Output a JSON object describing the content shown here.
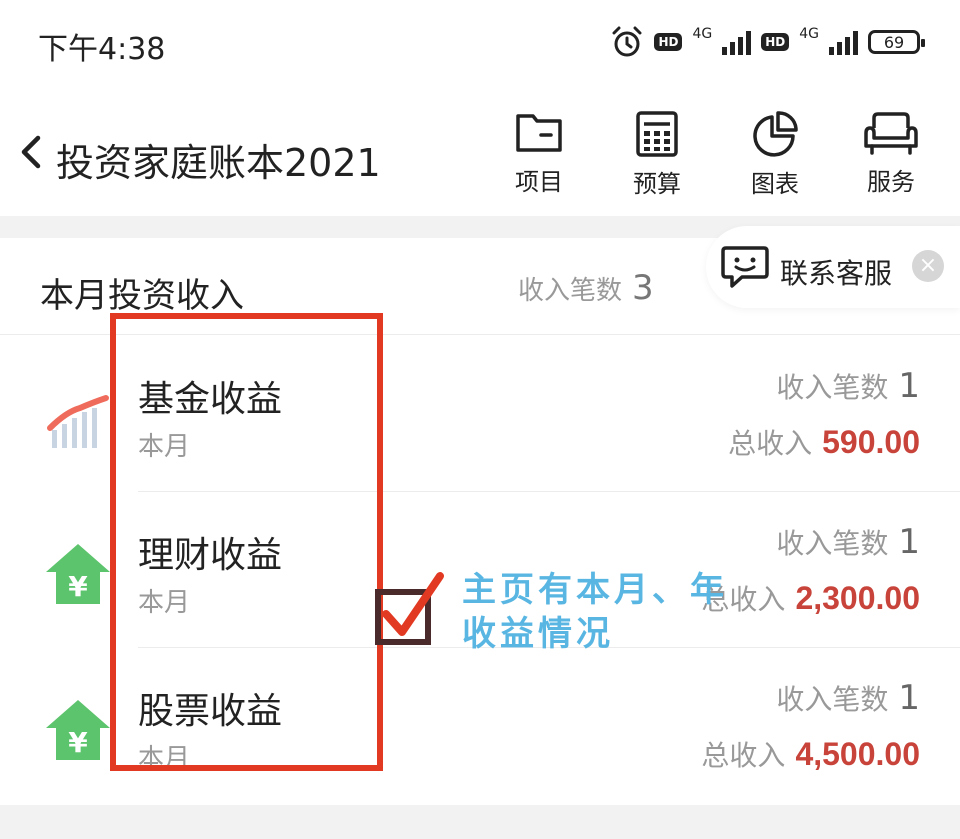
{
  "status_bar": {
    "time": "下午4:38",
    "hd_label": "HD",
    "network_label": "4G",
    "battery": "69"
  },
  "header": {
    "title": "投资家庭账本2021",
    "tools": [
      {
        "label": "项目",
        "icon": "folder-icon"
      },
      {
        "label": "预算",
        "icon": "calculator-icon"
      },
      {
        "label": "图表",
        "icon": "pie-chart-icon"
      },
      {
        "label": "服务",
        "icon": "sofa-icon"
      }
    ]
  },
  "summary": {
    "title": "本月投资收入",
    "count_label": "收入笔数",
    "count": "3"
  },
  "service": {
    "label": "联系客服"
  },
  "items": [
    {
      "name": "基金收益",
      "period": "本月",
      "count_label": "收入笔数",
      "count": "1",
      "total_label": "总收入",
      "total": "590.00",
      "icon": "trend-chart-icon"
    },
    {
      "name": "理财收益",
      "period": "本月",
      "count_label": "收入笔数",
      "count": "1",
      "total_label": "总收入",
      "total": "2,300.00",
      "icon": "yen-house-icon"
    },
    {
      "name": "股票收益",
      "period": "本月",
      "count_label": "收入笔数",
      "count": "1",
      "total_label": "总收入",
      "total": "4,500.00",
      "icon": "yen-house-icon"
    }
  ],
  "annotation": {
    "text": "主页有本月、年\n收益情况",
    "color": "#59b6e2",
    "box_color": "#e23a22"
  },
  "colors": {
    "amount": "#c8433a",
    "icon_green": "#5cc46c"
  }
}
